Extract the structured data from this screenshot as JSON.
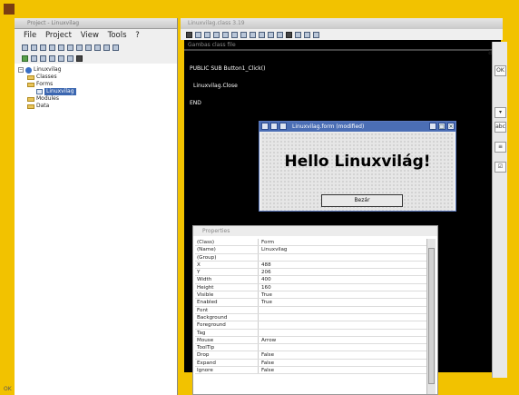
{
  "project": {
    "title": "Project - Linuxvilag",
    "menu": [
      "File",
      "Project",
      "View",
      "Tools",
      "?"
    ],
    "tree": [
      {
        "label": "Linuxvilag",
        "level": 0,
        "kind": "project"
      },
      {
        "label": "Classes",
        "level": 1,
        "kind": "folder"
      },
      {
        "label": "Forms",
        "level": 1,
        "kind": "folder"
      },
      {
        "label": "Linuxvilag",
        "level": 2,
        "kind": "form",
        "selected": true
      },
      {
        "label": "Modules",
        "level": 1,
        "kind": "folder"
      },
      {
        "label": "Data",
        "level": 1,
        "kind": "folder"
      }
    ],
    "status": "OK"
  },
  "editor": {
    "title": "Linuxvilag.class 3.19",
    "caption": "Gambas class file",
    "code": {
      "line1": "PUBLIC SUB Button1_Click()",
      "line2": "Linuxvilag.Close",
      "line3": "END"
    }
  },
  "form_window": {
    "title": "Linuxvilag.form (modified)",
    "hello_text": "Hello Linuxvilág!",
    "button_label": "Bezár",
    "buttons": [
      "_",
      "□",
      "×"
    ]
  },
  "properties": {
    "title": "Properties",
    "rows": [
      {
        "key": "(Class)",
        "value": "Form"
      },
      {
        "key": "(Name)",
        "value": "Linuxvilag"
      },
      {
        "key": "(Group)",
        "value": ""
      },
      {
        "key": "X",
        "value": "488"
      },
      {
        "key": "Y",
        "value": "206"
      },
      {
        "key": "Width",
        "value": "400"
      },
      {
        "key": "Height",
        "value": "160"
      },
      {
        "key": "Visible",
        "value": "True"
      },
      {
        "key": "Enabled",
        "value": "True"
      },
      {
        "key": "Font",
        "value": ""
      },
      {
        "key": "Background",
        "value": ""
      },
      {
        "key": "Foreground",
        "value": ""
      },
      {
        "key": "Tag",
        "value": ""
      },
      {
        "key": "Mouse",
        "value": "Arrow"
      },
      {
        "key": "ToolTip",
        "value": ""
      },
      {
        "key": "Drop",
        "value": "False"
      },
      {
        "key": "Expand",
        "value": "False"
      },
      {
        "key": "Ignore",
        "value": "False"
      }
    ]
  },
  "toolbox": {
    "label": "abc",
    "items": [
      "OK",
      "abc",
      "▾",
      "≡",
      "☑"
    ]
  },
  "colors": {
    "frame": "#f2c200",
    "selection": "#3b66b0",
    "editor_bg": "#000000",
    "form_titlebar": "#4b6eb5"
  }
}
